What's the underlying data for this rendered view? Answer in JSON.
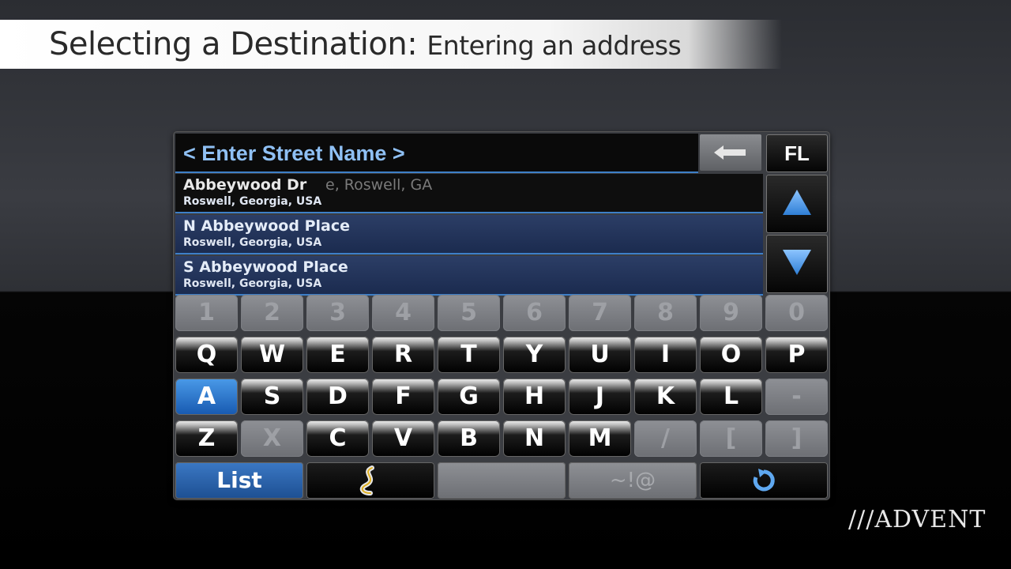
{
  "banner": {
    "title": "Selecting a Destination:",
    "subtitle": "Entering an address"
  },
  "entry": {
    "text": "< Enter Street Name >",
    "state": "FL"
  },
  "results": [
    {
      "name": "Abbeywood Dr",
      "sub": "Roswell, Georgia, USA",
      "ghost": "e, Roswell, GA"
    },
    {
      "name": "N Abbeywood Place",
      "sub": "Roswell, Georgia, USA"
    },
    {
      "name": "S Abbeywood Place",
      "sub": "Roswell, Georgia, USA"
    }
  ],
  "keyboard": {
    "numbers": [
      "1",
      "2",
      "3",
      "4",
      "5",
      "6",
      "7",
      "8",
      "9",
      "0"
    ],
    "row1": [
      "Q",
      "W",
      "E",
      "R",
      "T",
      "Y",
      "U",
      "I",
      "O",
      "P"
    ],
    "row2": [
      "A",
      "S",
      "D",
      "F",
      "G",
      "H",
      "J",
      "K",
      "L",
      "-"
    ],
    "row3": [
      "Z",
      "X",
      "C",
      "V",
      "B",
      "N",
      "M",
      "/",
      "[",
      "]"
    ],
    "bottom": {
      "list": "List",
      "symbols": "~!@"
    }
  },
  "colors": {
    "accent": "#3d7fc8",
    "selected_key": "#2f7fd6"
  },
  "icons": [
    "backspace-arrow-icon",
    "up-arrow-icon",
    "down-arrow-icon",
    "route-icon",
    "rotate-icon"
  ],
  "logo": "///ADVENT"
}
